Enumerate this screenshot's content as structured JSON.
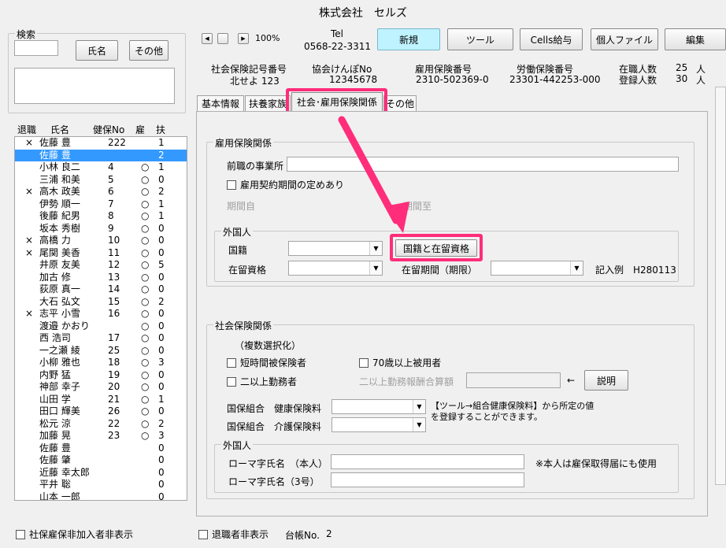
{
  "app": {
    "title": "株式会社　セルズ"
  },
  "search": {
    "label": "検索",
    "name_button": "氏名",
    "other_button": "その他"
  },
  "nav": {
    "zoom": "100%",
    "tel_label": "Tel",
    "tel": "0568-22-3311"
  },
  "toolbar": {
    "new": "新規",
    "tool": "ツール",
    "cells_salary": "Cells給与",
    "personal_file": "個人ファイル",
    "edit": "編集"
  },
  "info": {
    "social_no_label": "社会保険記号番号",
    "social_no": "北せよ 123",
    "kyokai_label": "協会けんぽNo",
    "kyokai": "12345678",
    "koyo_label": "雇用保険番号",
    "koyo": "2310-502369-0",
    "rodo_label": "労働保険番号",
    "rodo": "23301-442253-000",
    "enrolled_label": "在職人数",
    "enrolled": "25",
    "registered_label": "登録人数",
    "registered": "30",
    "unit": "人"
  },
  "employee_list": {
    "headers": {
      "retired": "退職",
      "name": "氏名",
      "kenpo": "健保No",
      "koyo": "雇",
      "fuyo": "扶"
    },
    "rows": [
      {
        "retired": "×",
        "name": "佐藤 豊",
        "kenpo": "222",
        "koyo": "",
        "fuyo": "1"
      },
      {
        "retired": "",
        "name": "佐藤 豊",
        "kenpo": "",
        "koyo": "",
        "fuyo": "2"
      },
      {
        "retired": "",
        "name": "小林 良二",
        "kenpo": "4",
        "koyo": "○",
        "fuyo": "1"
      },
      {
        "retired": "",
        "name": "三浦 和美",
        "kenpo": "5",
        "koyo": "○",
        "fuyo": "0"
      },
      {
        "retired": "×",
        "name": "高木 政美",
        "kenpo": "6",
        "koyo": "○",
        "fuyo": "2"
      },
      {
        "retired": "",
        "name": "伊勢 順一",
        "kenpo": "7",
        "koyo": "○",
        "fuyo": "1"
      },
      {
        "retired": "",
        "name": "後藤 紀男",
        "kenpo": "8",
        "koyo": "○",
        "fuyo": "1"
      },
      {
        "retired": "",
        "name": "坂本 秀樹",
        "kenpo": "9",
        "koyo": "○",
        "fuyo": "0"
      },
      {
        "retired": "×",
        "name": "高橋 力",
        "kenpo": "10",
        "koyo": "○",
        "fuyo": "0"
      },
      {
        "retired": "×",
        "name": "尾関 美香",
        "kenpo": "11",
        "koyo": "○",
        "fuyo": "0"
      },
      {
        "retired": "",
        "name": "井原 友美",
        "kenpo": "12",
        "koyo": "○",
        "fuyo": "5"
      },
      {
        "retired": "",
        "name": "加古 修",
        "kenpo": "13",
        "koyo": "○",
        "fuyo": "0"
      },
      {
        "retired": "",
        "name": "荻原 真一",
        "kenpo": "14",
        "koyo": "○",
        "fuyo": "0"
      },
      {
        "retired": "",
        "name": "大石 弘文",
        "kenpo": "15",
        "koyo": "○",
        "fuyo": "2"
      },
      {
        "retired": "×",
        "name": "志平 小雪",
        "kenpo": "16",
        "koyo": "○",
        "fuyo": "0"
      },
      {
        "retired": "",
        "name": "渡邉 かおり",
        "kenpo": "",
        "koyo": "○",
        "fuyo": "0"
      },
      {
        "retired": "",
        "name": "西 浩司",
        "kenpo": "17",
        "koyo": "○",
        "fuyo": "0"
      },
      {
        "retired": "",
        "name": "一之瀬 綾",
        "kenpo": "25",
        "koyo": "○",
        "fuyo": "0"
      },
      {
        "retired": "",
        "name": "小柳 雅也",
        "kenpo": "18",
        "koyo": "○",
        "fuyo": "3"
      },
      {
        "retired": "",
        "name": "内野 猛",
        "kenpo": "19",
        "koyo": "○",
        "fuyo": "0"
      },
      {
        "retired": "",
        "name": "神部 幸子",
        "kenpo": "20",
        "koyo": "○",
        "fuyo": "0"
      },
      {
        "retired": "",
        "name": "山田 学",
        "kenpo": "21",
        "koyo": "○",
        "fuyo": "1"
      },
      {
        "retired": "",
        "name": "田口 輝美",
        "kenpo": "26",
        "koyo": "○",
        "fuyo": "0"
      },
      {
        "retired": "",
        "name": "松元 涼",
        "kenpo": "22",
        "koyo": "○",
        "fuyo": "2"
      },
      {
        "retired": "",
        "name": "加藤 晃",
        "kenpo": "23",
        "koyo": "○",
        "fuyo": "3"
      },
      {
        "retired": "",
        "name": "佐藤 豊",
        "kenpo": "",
        "koyo": "",
        "fuyo": "0"
      },
      {
        "retired": "",
        "name": "佐藤 肇",
        "kenpo": "",
        "koyo": "",
        "fuyo": "0"
      },
      {
        "retired": "",
        "name": "近藤 幸太郎",
        "kenpo": "",
        "koyo": "",
        "fuyo": "0"
      },
      {
        "retired": "",
        "name": "平井 聡",
        "kenpo": "",
        "koyo": "",
        "fuyo": "0"
      },
      {
        "retired": "",
        "name": "山本 一郎",
        "kenpo": "",
        "koyo": "",
        "fuyo": "0"
      }
    ]
  },
  "tabs": {
    "basic": "基本情報",
    "dependents": "扶養家族",
    "social": "社会･雇用保険関係",
    "other": "その他"
  },
  "employment": {
    "group_label": "雇用保険関係",
    "prev_office_label": "前職の事業所",
    "contract_label": "雇用契約期間の定めあり",
    "period_start": "期間自",
    "period_end": "期間至",
    "foreigner_label": "外国人",
    "nationality_label": "国籍",
    "nationality_button": "国籍と在留資格",
    "status_label": "在留資格",
    "period_label": "在留期間（期限）",
    "example": "記入例　H280113"
  },
  "social": {
    "group_label": "社会保険関係",
    "multi_select": "（複数選択化）",
    "short_time": "短時間被保険者",
    "over70": "70歳以上被用者",
    "two_jobs": "二以上勤務者",
    "two_jobs_pay": "二以上勤務報酬合算額",
    "arrow": "←",
    "explain_button": "説明",
    "health_label": "国保組合　健康保険料",
    "care_label": "国保組合　介護保険料",
    "note_line1": "【ツール→組合健康保険料】から所定の値",
    "note_line2": "を登録することができます。",
    "foreigner_label": "外国人",
    "roman_name_label": "ローマ字氏名　（本人）",
    "roman_name_note": "※本人は雇保取得届にも使用",
    "roman_name3_label": "ローマ字氏名（3号）"
  },
  "footer": {
    "hide_unenrolled": "社保雇保非加入者非表示",
    "hide_retired": "退職者非表示",
    "ledger_label": "台帳No.",
    "ledger_no": "2"
  }
}
